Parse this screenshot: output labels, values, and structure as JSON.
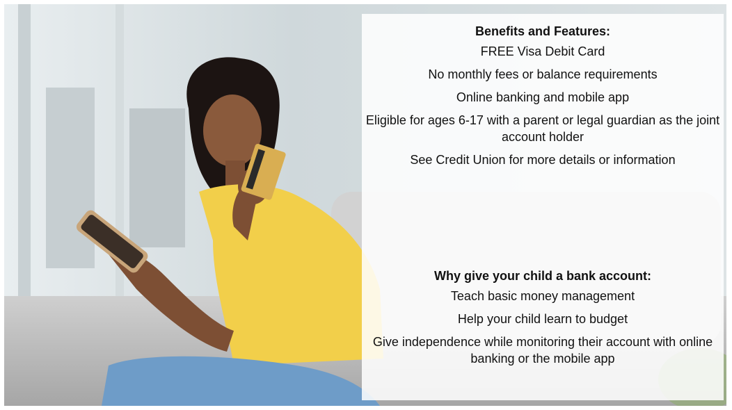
{
  "benefits": {
    "heading": "Benefits and Features:",
    "items": [
      "FREE Visa Debit Card",
      "No monthly fees or balance requirements",
      "Online banking and mobile app",
      "Eligible for ages 6-17 with a parent or legal guardian as the joint account holder",
      "See Credit Union for more details or information"
    ]
  },
  "why": {
    "heading": "Why give your child a bank account:",
    "items": [
      "Teach basic money management",
      "Help your child learn to budget",
      "Give independence while monitoring their account with online banking or the mobile app"
    ]
  },
  "colors": {
    "shirt": "#f2cf4a",
    "card": "#d9ae52",
    "sofa": "#d9d9d9"
  }
}
